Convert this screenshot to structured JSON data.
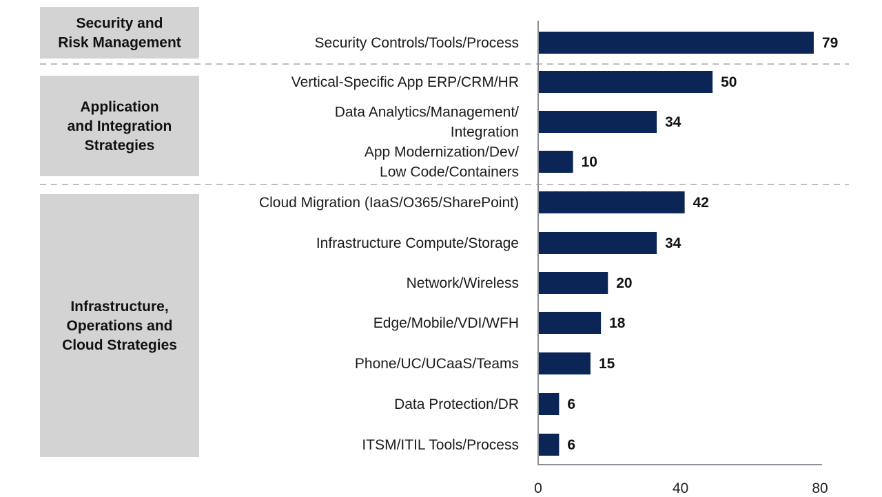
{
  "chart_data": {
    "type": "bar",
    "orientation": "horizontal",
    "title": "",
    "xlabel": "",
    "ylabel": "",
    "xlim": [
      0,
      80
    ],
    "xticks": [
      0,
      40,
      80
    ],
    "grid": false,
    "legend": "none",
    "bar_color": "#0b2656",
    "group_box_color": "#d3d3d3",
    "groups": [
      {
        "name": "Security and Risk Management",
        "label_lines": [
          "Security and",
          "Risk Management"
        ],
        "categories": [
          {
            "label_lines": [
              "Security Controls/Tools/Process"
            ],
            "value": 79
          }
        ]
      },
      {
        "name": "Application and Integration Strategies",
        "label_lines": [
          "Application",
          "and Integration",
          "Strategies"
        ],
        "categories": [
          {
            "label_lines": [
              "Vertical-Specific App ERP/CRM/HR"
            ],
            "value": 50
          },
          {
            "label_lines": [
              "Data Analytics/Management/",
              "Integration"
            ],
            "value": 34
          },
          {
            "label_lines": [
              "App Modernization/Dev/",
              "Low Code/Containers"
            ],
            "value": 10
          }
        ]
      },
      {
        "name": "Infrastructure, Operations and Cloud Strategies",
        "label_lines": [
          "Infrastructure,",
          "Operations and",
          "Cloud Strategies"
        ],
        "categories": [
          {
            "label_lines": [
              "Cloud Migration (IaaS/O365/SharePoint)"
            ],
            "value": 42
          },
          {
            "label_lines": [
              "Infrastructure Compute/Storage"
            ],
            "value": 34
          },
          {
            "label_lines": [
              "Network/Wireless"
            ],
            "value": 20
          },
          {
            "label_lines": [
              "Edge/Mobile/VDI/WFH"
            ],
            "value": 18
          },
          {
            "label_lines": [
              "Phone/UC/UCaaS/Teams"
            ],
            "value": 15
          },
          {
            "label_lines": [
              "Data Protection/DR"
            ],
            "value": 6
          },
          {
            "label_lines": [
              "ITSM/ITIL Tools/Process"
            ],
            "value": 6
          }
        ]
      }
    ]
  }
}
